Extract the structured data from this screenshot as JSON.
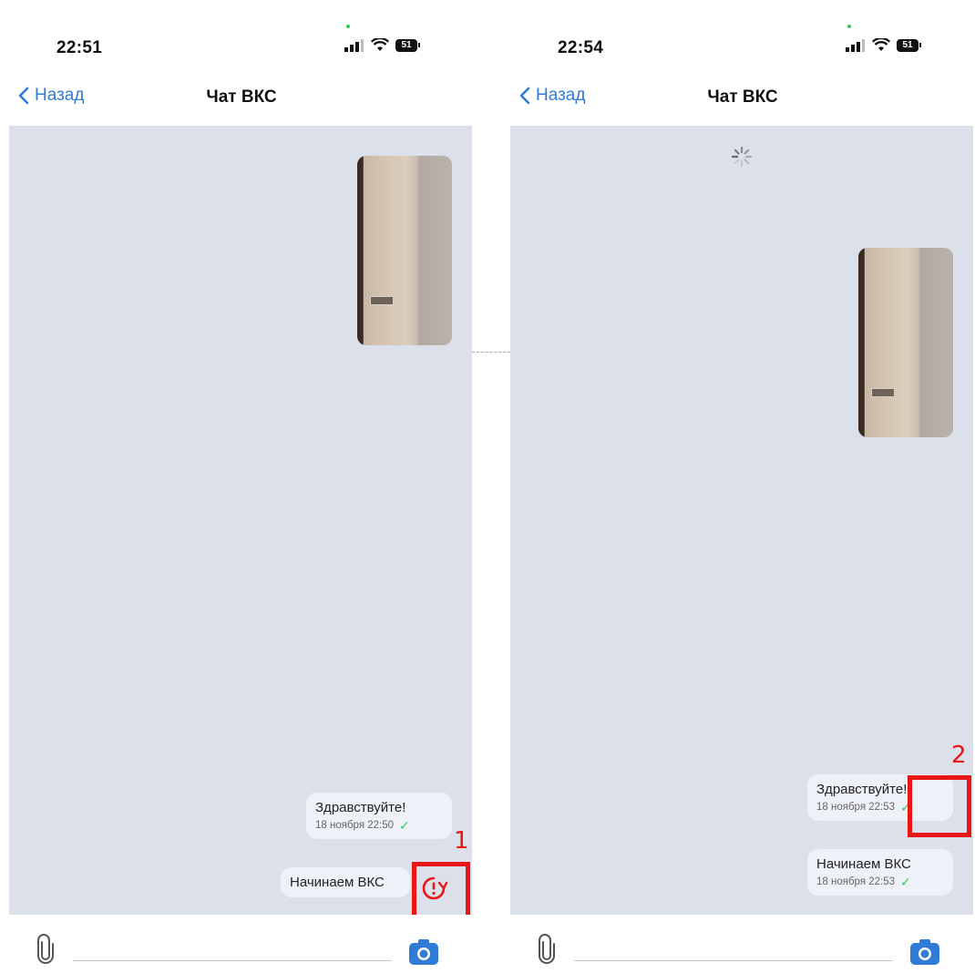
{
  "left_screen": {
    "status": {
      "time": "22:51",
      "battery": "51"
    },
    "nav": {
      "back_label": "Назад",
      "title": "Чат ВКС"
    },
    "messages": [
      {
        "text": "Здравствуйте!",
        "meta": "18 ноября 22:50",
        "status": "delivered"
      },
      {
        "text": "Начинаем ВКС",
        "status": "failed"
      }
    ],
    "annotation": "1"
  },
  "right_screen": {
    "status": {
      "time": "22:54",
      "battery": "51"
    },
    "nav": {
      "back_label": "Назад",
      "title": "Чат ВКС"
    },
    "messages": [
      {
        "text": "Здравствуйте!",
        "meta": "18 ноября 22:53",
        "status": "delivered"
      },
      {
        "text": "Начинаем ВКС",
        "meta": "18 ноября 22:53",
        "status": "delivered"
      }
    ],
    "annotation": "2"
  },
  "input": {
    "placeholder": ""
  },
  "colors": {
    "accent": "#2f7bd6",
    "chat_bg": "#dbe0ea",
    "bubble_bg": "#eef1f7",
    "check": "#35c759",
    "highlight": "#ea1515"
  },
  "icons": [
    "back-chevron-icon",
    "signal-icon",
    "wifi-icon",
    "battery-icon",
    "paperclip-icon",
    "camera-icon",
    "retry-icon",
    "loading-spinner-icon",
    "checkmark-icon"
  ]
}
